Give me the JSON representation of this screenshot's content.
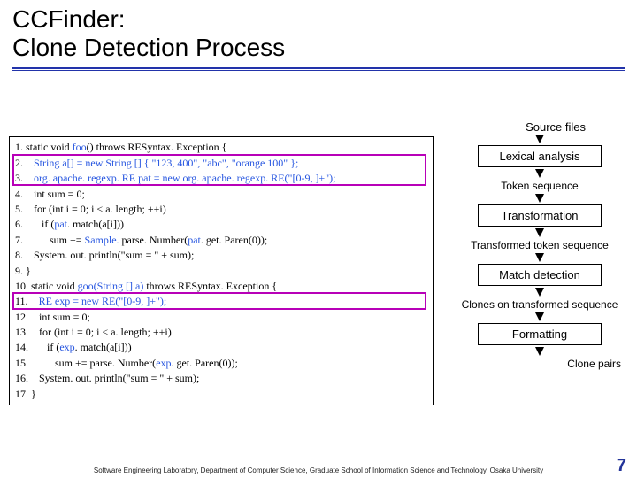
{
  "title": "CCFinder:\nClone Detection Process",
  "sourceLabel": "Source files",
  "pipeline": {
    "stage1": "Lexical analysis",
    "txt1": "Token sequence",
    "stage2": "Transformation",
    "txt2": "Transformed token sequence",
    "stage3": "Match detection",
    "txt3": "Clones on transformed sequence",
    "stage4": "Formatting",
    "txt4": "Clone pairs"
  },
  "code": {
    "l1a": "1. static void ",
    "l1b": "foo",
    "l1c": "() throws RESyntax. Exception {",
    "l2a": "2.    ",
    "l2b": "String a[] = new String [] { \"123, 400\", \"abc\", \"orange 100\" };",
    "l3a": "3.    ",
    "l3b": "org. apache. regexp. RE pat = new org. apache. regexp. RE(\"[0-9, ]+\");",
    "l4": "4.    int sum = 0;",
    "l5": "5.    for (int i = 0; i < a. length; ++i)",
    "l6a": "6.       if (",
    "l6b": "pat",
    "l6c": ". match(a[i]))",
    "l7a": "7.          sum += ",
    "l7b": "Sample. ",
    "l7c": "parse. Number(",
    "l7d": "pat",
    "l7e": ". get. Paren(0));",
    "l8": "8.    System. out. println(\"sum = \" + sum);",
    "l9": "9. }",
    "l10a": "10. static void ",
    "l10b": "goo(String [] a)",
    "l10c": " throws RESyntax. Exception {",
    "l11a": "11.    ",
    "l11b": "RE exp = new RE(\"[0-9, ]+\");",
    "l12": "12.    int sum = 0;",
    "l13": "13.    for (int i = 0; i < a. length; ++i)",
    "l14a": "14.       if (",
    "l14b": "exp",
    "l14c": ". match(a[i]))",
    "l15a": "15.          sum += parse. Number(",
    "l15b": "exp",
    "l15c": ". get. Paren(0));",
    "l16": "16.    System. out. println(\"sum = \" + sum);",
    "l17": "17. }"
  },
  "footer": "Software Engineering Laboratory, Department of Computer Science, Graduate School of Information Science and Technology, Osaka University",
  "pageNumber": "7"
}
